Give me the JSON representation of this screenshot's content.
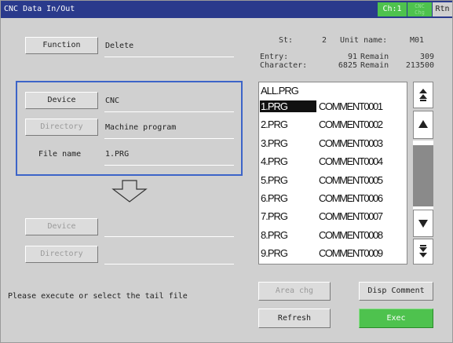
{
  "titlebar": {
    "title": "CNC Data In/Out",
    "channel": "Ch:1",
    "cnc_chg": [
      "CNC",
      "Chg"
    ],
    "rtn": "Rtn"
  },
  "function": {
    "button": "Function",
    "value": "Delete"
  },
  "source": {
    "device_button": "Device",
    "device_value": "CNC",
    "directory_button": "Directory",
    "directory_value": "Machine program",
    "file_name_label": "File name",
    "file_name_value": "1.PRG"
  },
  "destination": {
    "device_button": "Device",
    "device_value": "",
    "directory_button": "Directory",
    "directory_value": ""
  },
  "status": {
    "st_label": "St:",
    "st_value": "2",
    "unit_label": "Unit name:",
    "unit_value": "M01",
    "entry_label": "Entry:",
    "entry_value": "91",
    "entry_remain_label": "Remain",
    "entry_remain_value": "309",
    "char_label": "Character:",
    "char_value": "6825",
    "char_remain_label": "Remain",
    "char_remain_value": "213500"
  },
  "file_list": {
    "header": "ALL.PRG",
    "rows": [
      {
        "file": "1.PRG",
        "comment": "COMMENT0001",
        "selected": true
      },
      {
        "file": "2.PRG",
        "comment": "COMMENT0002"
      },
      {
        "file": "3.PRG",
        "comment": "COMMENT0003"
      },
      {
        "file": "4.PRG",
        "comment": "COMMENT0004"
      },
      {
        "file": "5.PRG",
        "comment": "COMMENT0005"
      },
      {
        "file": "6.PRG",
        "comment": "COMMENT0006"
      },
      {
        "file": "7.PRG",
        "comment": "COMMENT0007"
      },
      {
        "file": "8.PRG",
        "comment": "COMMENT0008"
      },
      {
        "file": "9.PRG",
        "comment": "COMMENT0009"
      }
    ]
  },
  "message": "Please execute or select the tail file",
  "buttons": {
    "area_chg": "Area chg",
    "disp_comment": "Disp Comment",
    "refresh": "Refresh",
    "exec": "Exec"
  },
  "colors": {
    "titlebar": "#2a3a8c",
    "accent_green": "#4ec24e",
    "panel": "#d0d0d0",
    "device_box": "#3c64c8"
  }
}
